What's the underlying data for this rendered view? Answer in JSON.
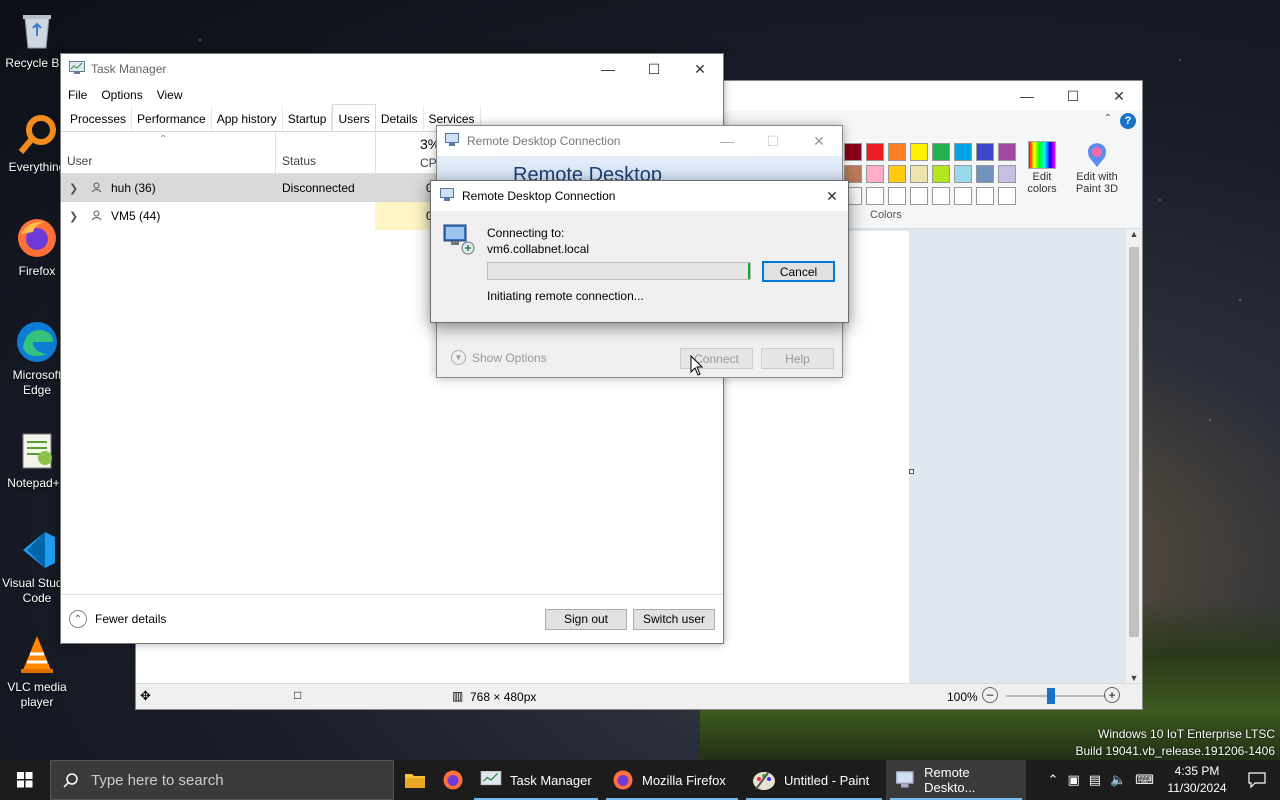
{
  "desktop": {
    "icons": [
      {
        "label": "Recycle Bin",
        "icon": "recycle-bin-icon"
      },
      {
        "label": "Everything",
        "icon": "everything-icon"
      },
      {
        "label": "Firefox",
        "icon": "firefox-icon"
      },
      {
        "label": "Microsoft Edge",
        "icon": "edge-icon"
      },
      {
        "label": "Notepad++",
        "icon": "notepadpp-icon"
      },
      {
        "label": "Visual Studio Code",
        "icon": "vscode-icon"
      },
      {
        "label": "VLC media player",
        "icon": "vlc-icon"
      }
    ],
    "watermark_line1": "Windows 10 IoT Enterprise LTSC",
    "watermark_line2": "Build 19041.vb_release.191206-1406"
  },
  "paint": {
    "edit_colors": "Edit colors",
    "edit_paint3d": "Edit with Paint 3D",
    "colors_label": "Colors",
    "image_size": "768 × 480px",
    "zoom": "100%",
    "palette": [
      "#880015",
      "#ed1c24",
      "#ff7f27",
      "#fff200",
      "#22b14c",
      "#00a2e8",
      "#3f48cc",
      "#a349a4",
      "#b97a57",
      "#ffaec9",
      "#ffc90e",
      "#efe4b0",
      "#b5e61d",
      "#99d9ea",
      "#7092be",
      "#c8bfe7",
      "#ffffff",
      "#ffffff",
      "#ffffff",
      "#ffffff",
      "#ffffff",
      "#ffffff",
      "#ffffff",
      "#ffffff"
    ]
  },
  "task_manager": {
    "title": "Task Manager",
    "menu": [
      "File",
      "Options",
      "View"
    ],
    "tabs": [
      "Processes",
      "Performance",
      "App history",
      "Startup",
      "Users",
      "Details",
      "Services"
    ],
    "active_tab": "Users",
    "columns": {
      "user": "User",
      "status": "Status",
      "cpu_pct": "3%",
      "cpu": "CPU"
    },
    "rows": [
      {
        "user": "huh (36)",
        "status": "Disconnected",
        "cpu": "0"
      },
      {
        "user": "VM5 (44)",
        "status": "",
        "cpu": "0"
      }
    ],
    "fewer_details": "Fewer details",
    "sign_out": "Sign out",
    "switch_user": "Switch user"
  },
  "rdc_back": {
    "title": "Remote Desktop Connection",
    "banner_title": "Remote Desktop",
    "show_options": "Show Options",
    "connect": "Connect",
    "help": "Help"
  },
  "rdc_front": {
    "title": "Remote Desktop Connection",
    "connecting_to": "Connecting to:",
    "host": "vm6.collabnet.local",
    "status": "Initiating remote connection...",
    "cancel": "Cancel"
  },
  "taskbar": {
    "search_placeholder": "Type here to search",
    "apps": [
      {
        "label": "Task Manager",
        "icon": "task-manager-icon"
      },
      {
        "label": "Mozilla Firefox",
        "icon": "firefox-icon"
      },
      {
        "label": "Untitled - Paint",
        "icon": "paint-icon"
      },
      {
        "label": "Remote Deskto...",
        "icon": "remote-desktop-icon"
      }
    ],
    "time": "4:35 PM",
    "date": "11/30/2024"
  }
}
